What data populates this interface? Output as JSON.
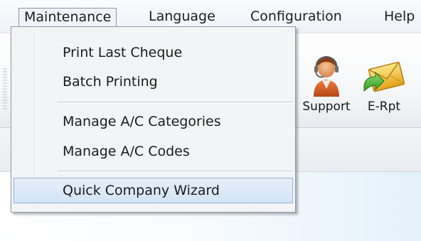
{
  "menubar": {
    "items": [
      {
        "label": "Maintenance",
        "open": true
      },
      {
        "label": "Language"
      },
      {
        "label": "Configuration"
      },
      {
        "label": "Help"
      }
    ]
  },
  "toolbar": {
    "buttons": [
      {
        "label": "Support",
        "icon": "support-person-icon"
      },
      {
        "label": "E-Rpt",
        "icon": "email-report-icon"
      }
    ]
  },
  "dropdown": {
    "items": [
      {
        "label": "Print Last Cheque"
      },
      {
        "label": "Batch Printing"
      },
      {
        "label": "Manage A/C Categories"
      },
      {
        "label": "Manage A/C Codes"
      },
      {
        "label": "Quick Company Wizard",
        "highlighted": true
      }
    ]
  },
  "colors": {
    "highlight_bg": "#d9e7f6",
    "highlight_border": "#8fb4de",
    "menu_border": "#8e99a8"
  }
}
